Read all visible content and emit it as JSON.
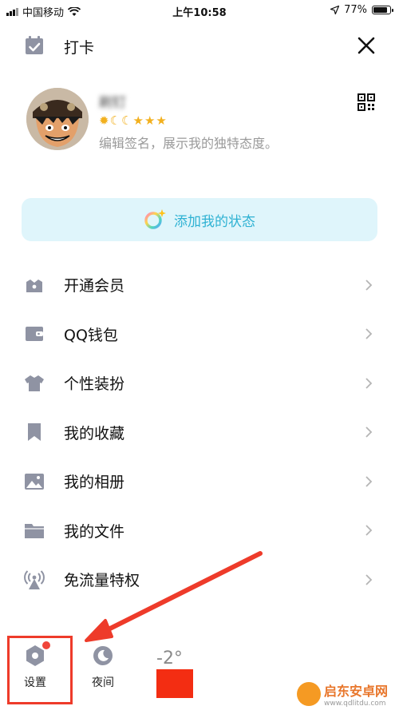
{
  "status_bar": {
    "carrier": "中国移动",
    "time": "上午10:58",
    "battery_percent": "77%",
    "battery_level": 0.77
  },
  "top": {
    "checkin_label": "打卡",
    "close_icon": "close-icon"
  },
  "profile": {
    "username": "刷钉",
    "level_icons": [
      "sun",
      "moon",
      "moon",
      "star",
      "star",
      "star"
    ],
    "signature": "编辑签名，展示我的独特态度。"
  },
  "add_status": {
    "label": "添加我的状态"
  },
  "menu": {
    "items": [
      {
        "label": "开通会员",
        "icon": "crown-icon"
      },
      {
        "label": "QQ钱包",
        "icon": "wallet-icon"
      },
      {
        "label": "个性装扮",
        "icon": "shirt-icon"
      },
      {
        "label": "我的收藏",
        "icon": "bookmark-icon"
      },
      {
        "label": "我的相册",
        "icon": "photo-icon"
      },
      {
        "label": "我的文件",
        "icon": "folder-icon"
      },
      {
        "label": "免流量特权",
        "icon": "antenna-icon"
      }
    ]
  },
  "bottom": {
    "settings_label": "设置",
    "night_label": "夜间",
    "temperature": "-2°"
  },
  "watermark": {
    "name": "启东安卓网",
    "url": "www.qdlitdu.com"
  },
  "colors": {
    "accent": "#2fb2d3",
    "status_bg": "#dff5fb",
    "icon_gray": "#8f93a3",
    "annotation_red": "#ee3b2a"
  }
}
